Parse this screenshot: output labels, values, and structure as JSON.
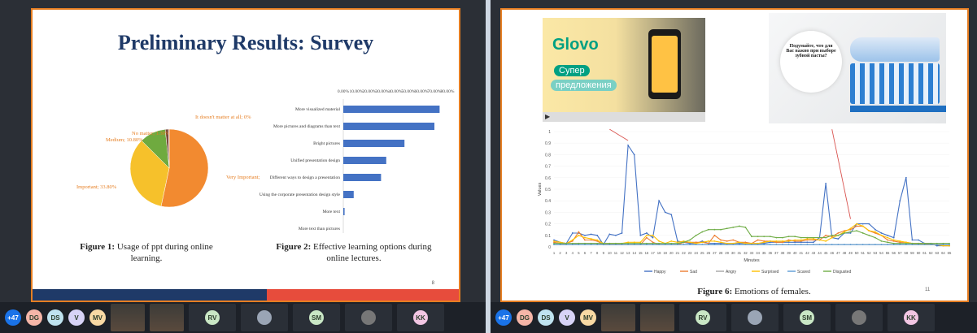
{
  "left_screen": {
    "slide_title": "Preliminary Results: Survey",
    "page_number": "8",
    "fig1": {
      "label": "Figure 1:",
      "caption": "Usage of ppt during online learning.",
      "slices": [
        {
          "label": "Very Important; 52.80%",
          "value": 52.8,
          "color": "#f28a30"
        },
        {
          "label": "Important; 33.80%",
          "value": 33.8,
          "color": "#f6c12b"
        },
        {
          "label": "Medium; 10.80%",
          "value": 10.8,
          "color": "#6faa3f"
        },
        {
          "label": "No matter; 1.30%",
          "value": 1.3,
          "color": "#7b4a3a"
        },
        {
          "label": "It doesn't matter at all; 0%",
          "value": 0.3,
          "color": "#ad3a2a"
        }
      ]
    },
    "fig2": {
      "label": "Figure 2:",
      "caption": "Effective learning options during online lectures.",
      "ticks": [
        "0.00%",
        "10.00%",
        "20.00%",
        "30.00%",
        "40.00%",
        "50.00%",
        "60.00%",
        "70.00%",
        "80.00%"
      ],
      "bars": [
        {
          "label": "More visualized material",
          "value": 74
        },
        {
          "label": "More pictures and diagrams than text",
          "value": 70
        },
        {
          "label": "Bright pictures",
          "value": 47
        },
        {
          "label": "Unified presentation design",
          "value": 33
        },
        {
          "label": "Different ways to design a presentation",
          "value": 29
        },
        {
          "label": "Using the corporate presentation design style",
          "value": 8
        },
        {
          "label": "More text",
          "value": 1
        },
        {
          "label": "More text than pictures",
          "value": 0
        }
      ]
    },
    "participants": [
      "+47",
      "DG",
      "DS",
      "V",
      "MV",
      "RV",
      "SM",
      "KK"
    ]
  },
  "right_screen": {
    "video": {
      "brand": "Glovo",
      "badge_line1": "Супер",
      "badge_line2": "предложения"
    },
    "toothpaste_text": "Подумайте, что для Вас важно при выборе зубной пасты?",
    "fig6": {
      "label": "Figure 6:",
      "caption": "Emotions of females.",
      "page_number": "11"
    },
    "chart_data": {
      "type": "line",
      "title": "",
      "xlabel": "Minutes",
      "ylabel": "Values",
      "ylim": [
        0,
        1
      ],
      "yticks": [
        "0",
        "0.1",
        "0.2",
        "0.3",
        "0.4",
        "0.5",
        "0.6",
        "0.7",
        "0.8",
        "0.9",
        "1"
      ],
      "x": [
        1,
        2,
        3,
        4,
        5,
        6,
        7,
        8,
        9,
        10,
        11,
        12,
        13,
        14,
        15,
        16,
        17,
        18,
        19,
        20,
        21,
        22,
        23,
        24,
        25,
        26,
        27,
        28,
        29,
        30,
        31,
        32,
        33,
        34,
        35,
        36,
        37,
        38,
        39,
        40,
        41,
        42,
        43,
        44,
        45,
        46,
        47,
        48,
        49,
        50,
        51,
        52,
        53,
        54,
        55,
        56,
        57,
        58,
        59,
        60,
        61,
        62,
        63,
        64,
        65
      ],
      "series": [
        {
          "name": "Happy",
          "color": "#4472c4",
          "values": [
            0.06,
            0.04,
            0.03,
            0.12,
            0.12,
            0.1,
            0.11,
            0.1,
            0.02,
            0.11,
            0.1,
            0.12,
            0.88,
            0.8,
            0.1,
            0.12,
            0.08,
            0.4,
            0.3,
            0.28,
            0.05,
            0.04,
            0.03,
            0.03,
            0.05,
            0.03,
            0.03,
            0.03,
            0.03,
            0.03,
            0.03,
            0.03,
            0.03,
            0.03,
            0.03,
            0.04,
            0.04,
            0.04,
            0.04,
            0.04,
            0.04,
            0.04,
            0.04,
            0.08,
            0.55,
            0.08,
            0.07,
            0.12,
            0.12,
            0.2,
            0.2,
            0.2,
            0.15,
            0.12,
            0.1,
            0.08,
            0.4,
            0.6,
            0.06,
            0.06,
            0.03,
            0.03,
            0.01,
            0.01,
            0.01
          ]
        },
        {
          "name": "Sad",
          "color": "#ed7d31",
          "values": [
            0.04,
            0.03,
            0.03,
            0.05,
            0.13,
            0.06,
            0.06,
            0.05,
            0.02,
            0.02,
            0.02,
            0.02,
            0.02,
            0.02,
            0.02,
            0.08,
            0.04,
            0.02,
            0.02,
            0.02,
            0.02,
            0.04,
            0.04,
            0.04,
            0.04,
            0.03,
            0.1,
            0.06,
            0.05,
            0.06,
            0.04,
            0.04,
            0.03,
            0.06,
            0.05,
            0.05,
            0.04,
            0.04,
            0.06,
            0.05,
            0.05,
            0.06,
            0.06,
            0.06,
            0.1,
            0.09,
            0.12,
            0.14,
            0.15,
            0.18,
            0.18,
            0.14,
            0.12,
            0.1,
            0.06,
            0.05,
            0.04,
            0.04,
            0.03,
            0.03,
            0.03,
            0.02,
            0.02,
            0.01,
            0.01
          ]
        },
        {
          "name": "Angry",
          "color": "#a5a5a5",
          "values": [
            0.02,
            0.02,
            0.02,
            0.02,
            0.03,
            0.03,
            0.03,
            0.03,
            0.02,
            0.02,
            0.02,
            0.02,
            0.02,
            0.02,
            0.02,
            0.02,
            0.02,
            0.02,
            0.02,
            0.02,
            0.02,
            0.02,
            0.02,
            0.02,
            0.02,
            0.02,
            0.02,
            0.02,
            0.02,
            0.02,
            0.02,
            0.02,
            0.02,
            0.02,
            0.02,
            0.02,
            0.02,
            0.02,
            0.02,
            0.02,
            0.02,
            0.02,
            0.02,
            0.02,
            0.02,
            0.02,
            0.02,
            0.02,
            0.02,
            0.02,
            0.02,
            0.02,
            0.02,
            0.02,
            0.02,
            0.02,
            0.02,
            0.02,
            0.02,
            0.02,
            0.02,
            0.02,
            0.02,
            0.02,
            0.02
          ]
        },
        {
          "name": "Surprised",
          "color": "#ffc000",
          "values": [
            0.05,
            0.04,
            0.03,
            0.06,
            0.1,
            0.08,
            0.07,
            0.06,
            0.03,
            0.03,
            0.03,
            0.03,
            0.04,
            0.04,
            0.04,
            0.1,
            0.1,
            0.05,
            0.03,
            0.05,
            0.04,
            0.05,
            0.04,
            0.03,
            0.04,
            0.05,
            0.05,
            0.04,
            0.03,
            0.03,
            0.04,
            0.03,
            0.03,
            0.03,
            0.04,
            0.05,
            0.05,
            0.05,
            0.05,
            0.06,
            0.06,
            0.07,
            0.07,
            0.06,
            0.05,
            0.08,
            0.1,
            0.13,
            0.16,
            0.2,
            0.18,
            0.14,
            0.13,
            0.1,
            0.08,
            0.06,
            0.05,
            0.04,
            0.03,
            0.03,
            0.02,
            0.02,
            0.02,
            0.01,
            0.01
          ]
        },
        {
          "name": "Scared",
          "color": "#5b9bd5",
          "values": [
            0.02,
            0.02,
            0.02,
            0.02,
            0.02,
            0.02,
            0.02,
            0.02,
            0.02,
            0.02,
            0.02,
            0.02,
            0.02,
            0.02,
            0.02,
            0.02,
            0.02,
            0.02,
            0.02,
            0.02,
            0.02,
            0.02,
            0.02,
            0.02,
            0.02,
            0.02,
            0.02,
            0.02,
            0.02,
            0.02,
            0.02,
            0.02,
            0.02,
            0.02,
            0.02,
            0.02,
            0.02,
            0.02,
            0.02,
            0.02,
            0.02,
            0.02,
            0.02,
            0.02,
            0.02,
            0.02,
            0.02,
            0.02,
            0.02,
            0.02,
            0.02,
            0.02,
            0.02,
            0.02,
            0.02,
            0.02,
            0.02,
            0.02,
            0.02,
            0.02,
            0.02,
            0.02,
            0.02,
            0.02,
            0.02
          ]
        },
        {
          "name": "Disgusted",
          "color": "#70ad47",
          "values": [
            0.03,
            0.03,
            0.03,
            0.03,
            0.03,
            0.03,
            0.03,
            0.03,
            0.03,
            0.03,
            0.03,
            0.03,
            0.03,
            0.03,
            0.03,
            0.03,
            0.03,
            0.03,
            0.03,
            0.03,
            0.03,
            0.04,
            0.06,
            0.1,
            0.13,
            0.15,
            0.15,
            0.15,
            0.16,
            0.17,
            0.18,
            0.17,
            0.09,
            0.09,
            0.09,
            0.09,
            0.08,
            0.08,
            0.09,
            0.09,
            0.08,
            0.08,
            0.08,
            0.08,
            0.08,
            0.1,
            0.1,
            0.12,
            0.13,
            0.14,
            0.12,
            0.1,
            0.08,
            0.05,
            0.04,
            0.03,
            0.03,
            0.03,
            0.03,
            0.03,
            0.03,
            0.03,
            0.03,
            0.03,
            0.03
          ]
        }
      ]
    },
    "participants": [
      "+47",
      "DG",
      "DS",
      "V",
      "MV",
      "RV",
      "SM",
      "KK"
    ]
  },
  "colors": {
    "title": "#1f3a68",
    "bar": "#4472c4",
    "slide_border": "#e67e22"
  }
}
